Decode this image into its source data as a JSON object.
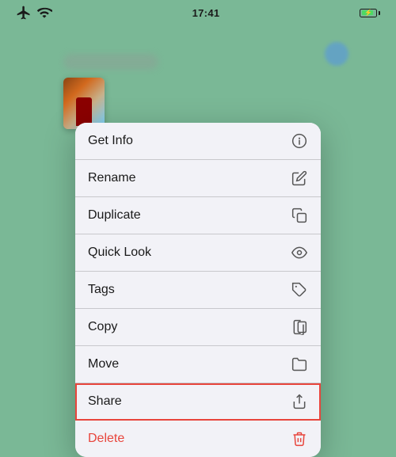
{
  "statusBar": {
    "time": "17:41",
    "batteryPercent": 85
  },
  "background": {
    "color": "#7ab896"
  },
  "contextMenu": {
    "items": [
      {
        "id": "get-info",
        "label": "Get Info",
        "icon": "info-circle"
      },
      {
        "id": "rename",
        "label": "Rename",
        "icon": "pencil"
      },
      {
        "id": "duplicate",
        "label": "Duplicate",
        "icon": "duplicate"
      },
      {
        "id": "quick-look",
        "label": "Quick Look",
        "icon": "eye"
      },
      {
        "id": "tags",
        "label": "Tags",
        "icon": "tag"
      },
      {
        "id": "copy",
        "label": "Copy",
        "icon": "copy"
      },
      {
        "id": "move",
        "label": "Move",
        "icon": "folder"
      },
      {
        "id": "share",
        "label": "Share",
        "icon": "share",
        "highlighted": true
      },
      {
        "id": "delete",
        "label": "Delete",
        "icon": "trash",
        "destructive": true
      }
    ]
  }
}
